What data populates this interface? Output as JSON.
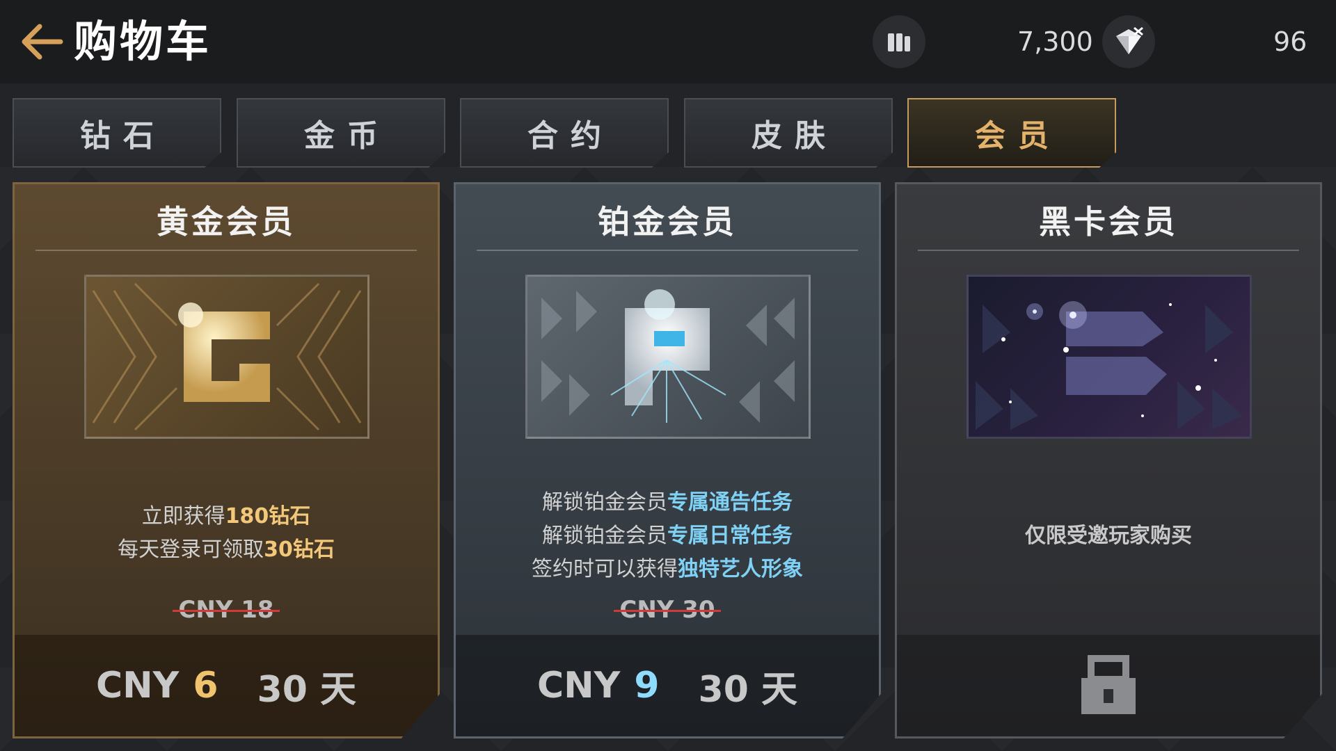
{
  "header": {
    "title": "购物车",
    "back_icon": "back-arrow-icon",
    "currency1": {
      "icon": "coins-icon",
      "value": "7,300"
    },
    "currency2": {
      "icon": "diamond-icon",
      "value": "96"
    }
  },
  "tabs": [
    {
      "label": "钻石",
      "active": false
    },
    {
      "label": "金币",
      "active": false
    },
    {
      "label": "合约",
      "active": false
    },
    {
      "label": "皮肤",
      "active": false
    },
    {
      "label": "会员",
      "active": true
    }
  ],
  "cards": {
    "gold": {
      "title": "黄金会员",
      "desc1_pre": "立即获得",
      "desc1_hl": "180钻石",
      "desc2_pre": "每天登录可领取",
      "desc2_hl": "30钻石",
      "old_price": "CNY 18",
      "currency": "CNY",
      "price": "6",
      "duration": "30 天",
      "accent": "#f0c36f"
    },
    "platinum": {
      "title": "铂金会员",
      "desc1_pre": "解锁铂金会员",
      "desc1_hl": "专属通告任务",
      "desc2_pre": "解锁铂金会员",
      "desc2_hl": "专属日常任务",
      "desc3_pre": "签约时可以获得",
      "desc3_hl": "独特艺人形象",
      "old_price": "CNY 30",
      "currency": "CNY",
      "price": "9",
      "duration": "30 天",
      "accent": "#8fdcff"
    },
    "black": {
      "title": "黑卡会员",
      "desc": "仅限受邀玩家购买",
      "lock_icon": "lock-icon"
    }
  }
}
